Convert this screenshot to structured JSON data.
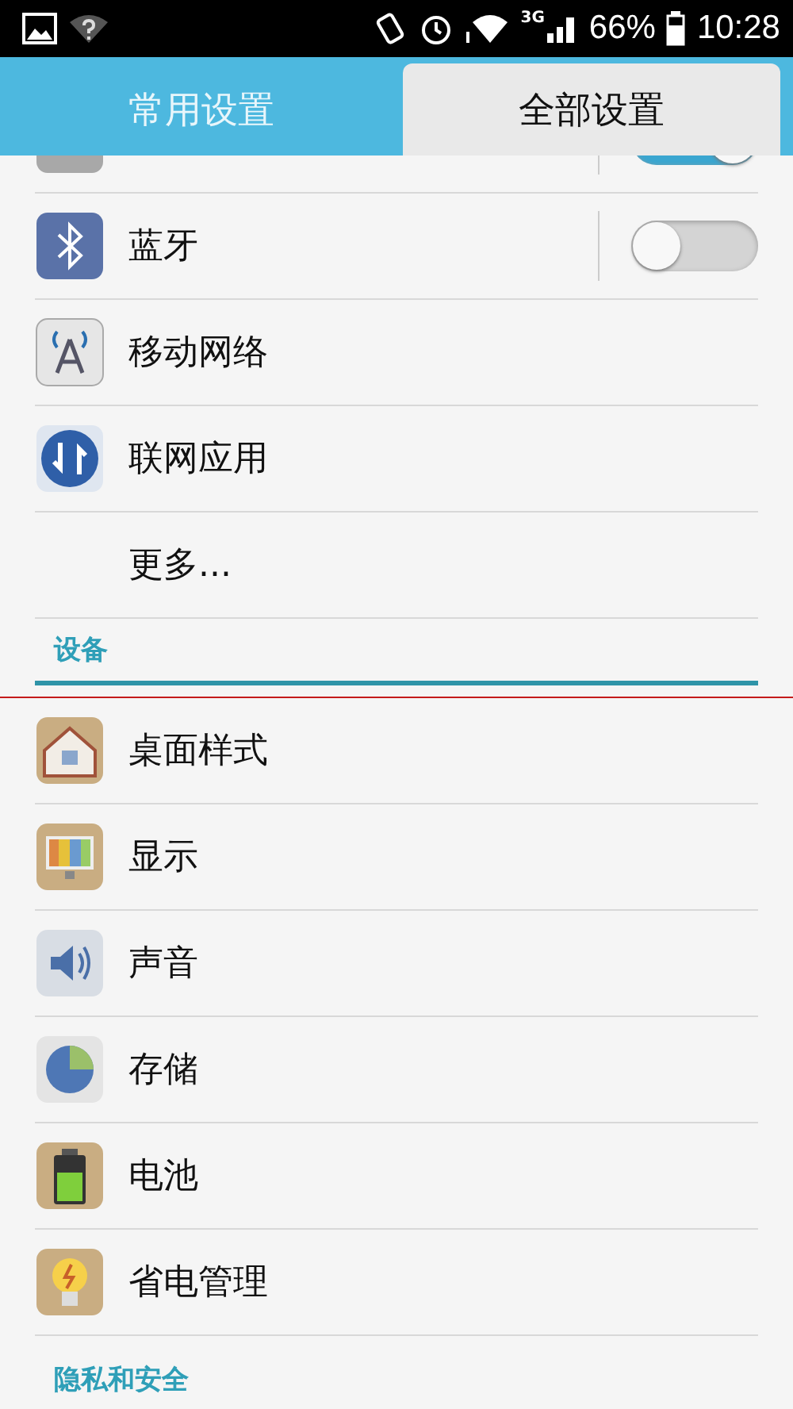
{
  "status_bar": {
    "network": "3G",
    "battery": "66%",
    "time": "10:28"
  },
  "tabs": [
    {
      "label": "常用设置",
      "selected": false
    },
    {
      "label": "全部设置",
      "selected": true
    }
  ],
  "rows": [
    {
      "kind": "cut",
      "on": true
    },
    {
      "kind": "toggle",
      "label": "蓝牙",
      "on": false
    },
    {
      "kind": "link",
      "label": "移动网络"
    },
    {
      "kind": "link",
      "label": "联网应用"
    },
    {
      "kind": "link",
      "label": "更多..."
    },
    {
      "kind": "header",
      "label": "设备"
    },
    {
      "kind": "link",
      "label": "桌面样式"
    },
    {
      "kind": "link",
      "label": "显示"
    },
    {
      "kind": "link",
      "label": "声音"
    },
    {
      "kind": "link",
      "label": "存储"
    },
    {
      "kind": "link",
      "label": "电池"
    },
    {
      "kind": "link",
      "label": "省电管理"
    },
    {
      "kind": "header",
      "label": "隐私和安全"
    }
  ]
}
